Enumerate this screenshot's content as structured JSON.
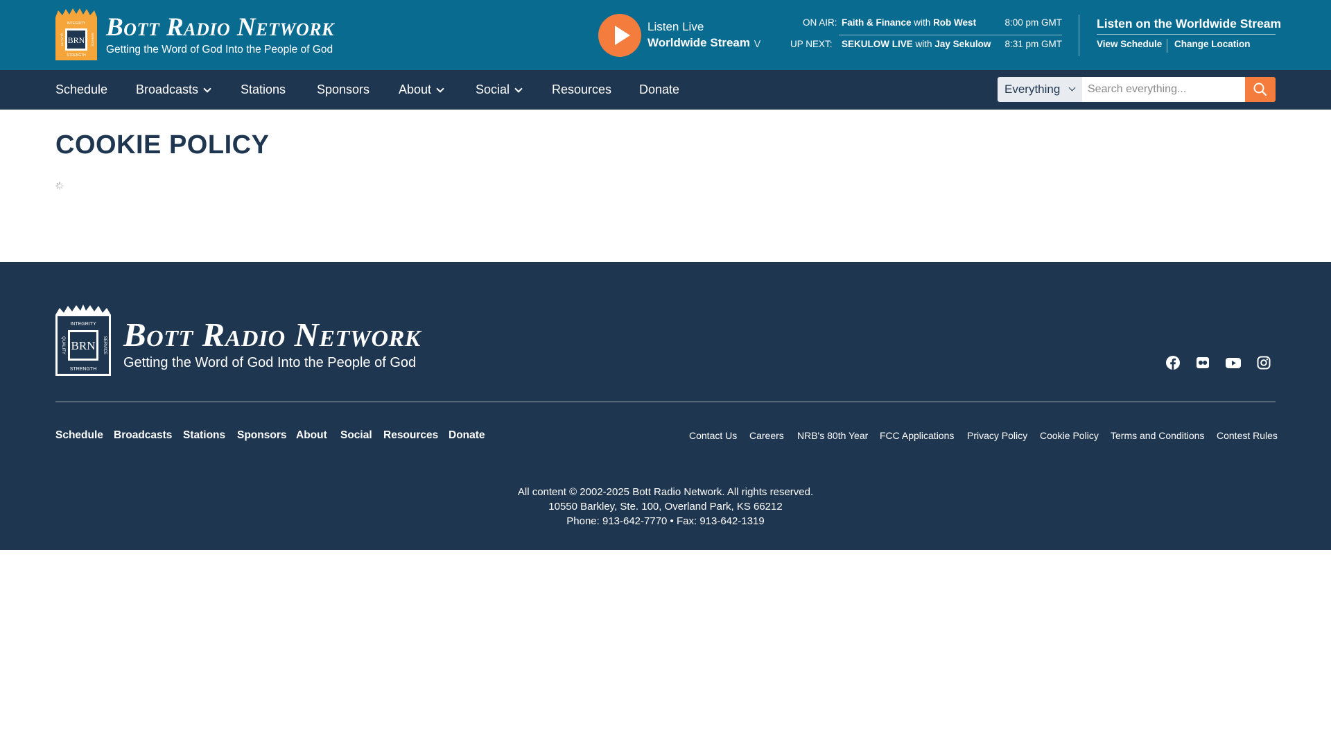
{
  "brand": {
    "name": "Bott Radio Network",
    "tagline": "Getting the Word of God Into the People of God",
    "badge_text": "BRN",
    "badge_words": [
      "INTEGRITY",
      "QUALITY",
      "SERVICE",
      "STRENGTH"
    ]
  },
  "listen": {
    "label": "Listen Live",
    "stream": "Worldwide Stream"
  },
  "now_playing": {
    "on_air_label": "ON AIR:",
    "on_air_show": "Faith & Finance",
    "on_air_with": "with",
    "on_air_host": "Rob West",
    "on_air_time": "8:00 pm GMT",
    "up_next_label": "UP NEXT:",
    "up_next_show": "SEKULOW LIVE",
    "up_next_with": "with",
    "up_next_host": "Jay Sekulow",
    "up_next_time": "8:31 pm GMT"
  },
  "worldwide": {
    "title": "Listen on the Worldwide Stream",
    "view_schedule": "View Schedule",
    "change_location": "Change Location"
  },
  "nav": {
    "items": [
      {
        "label": "Schedule",
        "has_dropdown": false
      },
      {
        "label": "Broadcasts",
        "has_dropdown": true
      },
      {
        "label": "Stations",
        "has_dropdown": false
      },
      {
        "label": "Sponsors",
        "has_dropdown": false
      },
      {
        "label": "About",
        "has_dropdown": true
      },
      {
        "label": "Social",
        "has_dropdown": true
      },
      {
        "label": "Resources",
        "has_dropdown": false
      },
      {
        "label": "Donate",
        "has_dropdown": false
      }
    ]
  },
  "search": {
    "scope": "Everything",
    "placeholder": "Search everything...",
    "icon": "search-icon"
  },
  "page": {
    "title": "COOKIE POLICY"
  },
  "footer": {
    "social_icons": [
      "facebook-icon",
      "flickr-icon",
      "youtube-icon",
      "instagram-icon"
    ],
    "nav": [
      "Schedule",
      "Broadcasts",
      "Stations",
      "Sponsors",
      "About",
      "Social",
      "Resources",
      "Donate"
    ],
    "links": [
      "Contact Us",
      "Careers",
      "NRB's 80th Year",
      "FCC Applications",
      "Privacy Policy",
      "Cookie Policy",
      "Terms and Conditions",
      "Contest Rules"
    ],
    "copyright": "All content © 2002-2025 Bott Radio Network. All rights reserved.",
    "address": "10550 Barkley, Ste. 100, Overland Park, KS 66212",
    "phone": "Phone: 913-642-7770 • Fax: 913-642-1319"
  },
  "colors": {
    "header_bg": "#0a6b91",
    "nav_bg": "#1f3650",
    "accent": "#f47c3c",
    "title_text": "#1f3650"
  }
}
